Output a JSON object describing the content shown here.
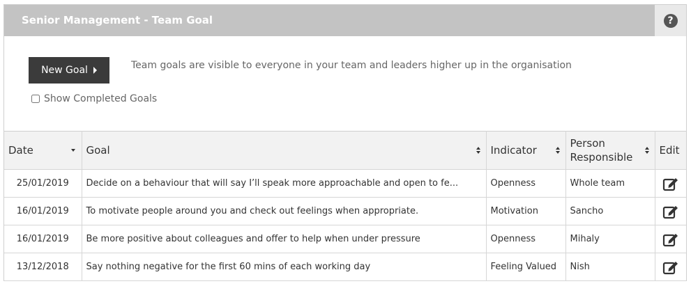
{
  "panel": {
    "title": "Senior Management - Team Goal",
    "help_icon": "question-circle-icon"
  },
  "actions": {
    "new_goal_label": "New Goal",
    "info_text": "Team goals are visible to everyone in your team and leaders higher up in the organisation",
    "show_completed_label": "Show Completed Goals",
    "show_completed_checked": false
  },
  "table": {
    "headers": {
      "date": "Date",
      "goal": "Goal",
      "indicator": "Indicator",
      "person_line1": "Person",
      "person_line2": "Responsible",
      "edit": "Edit"
    },
    "rows": [
      {
        "date": "25/01/2019",
        "goal": "Decide on a behaviour that will say I’ll speak more approachable and open to fe...",
        "indicator": "Openness",
        "person": "Whole team"
      },
      {
        "date": "16/01/2019",
        "goal": "To motivate people around you and check out feelings when appropriate.",
        "indicator": "Motivation",
        "person": "Sancho"
      },
      {
        "date": "16/01/2019",
        "goal": "Be more positive about colleagues and offer to help when under pressure",
        "indicator": "Openness",
        "person": "Mihaly"
      },
      {
        "date": "13/12/2018",
        "goal": "Say nothing negative for the first 60 mins of each working day",
        "indicator": "Feeling Valued",
        "person": "Nish"
      }
    ]
  },
  "colors": {
    "header_bg": "#c3c3c3",
    "button_bg": "#3b3b3b",
    "table_header_bg": "#f2f2f2"
  }
}
